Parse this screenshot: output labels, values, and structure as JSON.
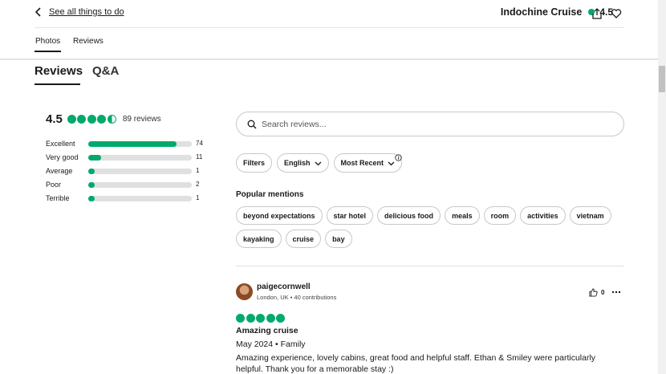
{
  "header": {
    "back_label": "See all things to do",
    "title": "Indochine Cruise",
    "rating": "4.5",
    "brand_color": "#00aa6c"
  },
  "top_tabs": [
    {
      "label": "Photos",
      "active": true
    },
    {
      "label": "Reviews",
      "active": false
    }
  ],
  "section_tabs": [
    {
      "label": "Reviews",
      "active": true
    },
    {
      "label": "Q&A",
      "active": false
    }
  ],
  "summary": {
    "score": "4.5",
    "review_count": "89 reviews",
    "bubbles_filled": 4.5,
    "distribution": [
      {
        "label": "Excellent",
        "count": "74",
        "value": 74
      },
      {
        "label": "Very good",
        "count": "11",
        "value": 11
      },
      {
        "label": "Average",
        "count": "1",
        "value": 1
      },
      {
        "label": "Poor",
        "count": "2",
        "value": 2
      },
      {
        "label": "Terrible",
        "count": "1",
        "value": 1
      }
    ]
  },
  "search": {
    "placeholder": "Search reviews...",
    "value": ""
  },
  "filters": {
    "filters_label": "Filters",
    "language_label": "English",
    "sort_label": "Most Recent"
  },
  "popular_mentions": {
    "title": "Popular mentions",
    "items": [
      "beyond expectations",
      "star hotel",
      "delicious food",
      "meals",
      "room",
      "activities",
      "vietnam",
      "kayaking",
      "cruise",
      "bay"
    ]
  },
  "review": {
    "username": "paigecornwell",
    "meta": "London, UK • 40 contributions",
    "likes": "0",
    "rating": 5,
    "title": "Amazing cruise",
    "date": "May 2024 • Family",
    "body": "Amazing experience, lovely cabins, great food and helpful staff. Ethan & Smiley were particularly helpful. Thank you for a memorable stay :)"
  }
}
